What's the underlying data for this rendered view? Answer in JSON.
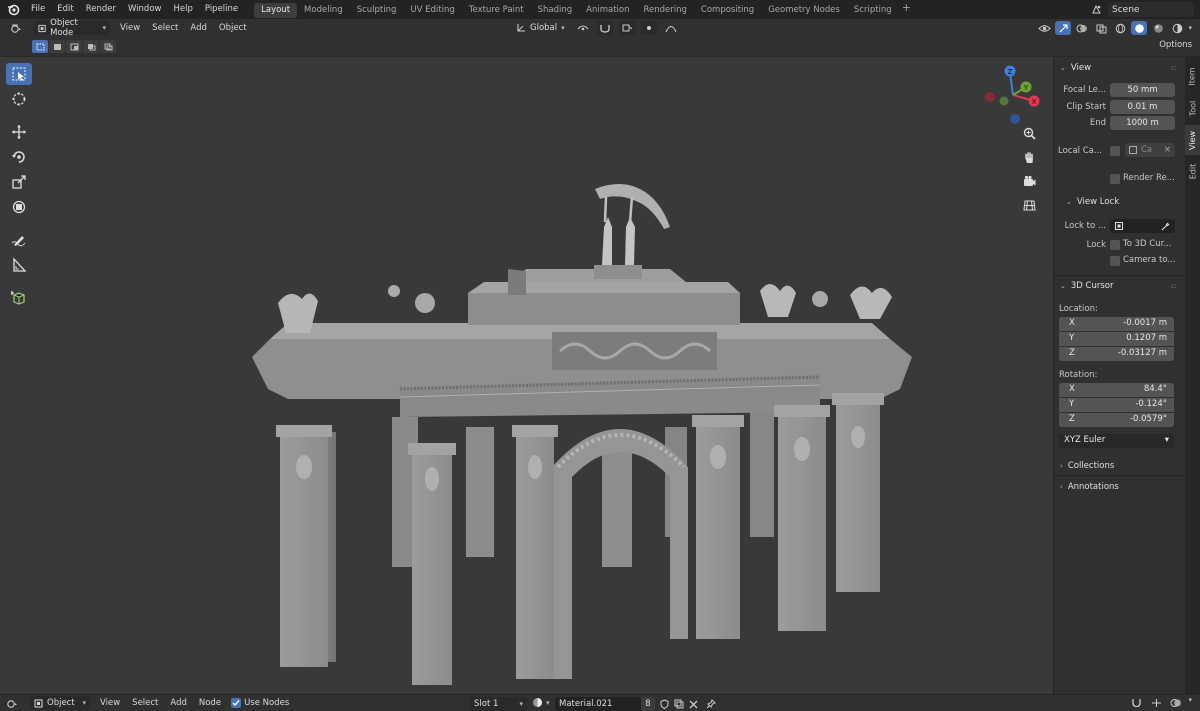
{
  "topbar": {
    "menus": [
      "File",
      "Edit",
      "Render",
      "Window",
      "Help",
      "Pipeline"
    ],
    "workspaces": [
      "Layout",
      "Modeling",
      "Sculpting",
      "UV Editing",
      "Texture Paint",
      "Shading",
      "Animation",
      "Rendering",
      "Compositing",
      "Geometry Nodes",
      "Scripting"
    ],
    "active_workspace": "Layout",
    "add_workspace": "+",
    "scene_name": "Scene"
  },
  "viewport_header": {
    "mode": "Object Mode",
    "menus": [
      "View",
      "Select",
      "Add",
      "Object"
    ],
    "orientation": "Global"
  },
  "tool_settings": {
    "options_label": "Options"
  },
  "sidebar": {
    "tabs": [
      "Item",
      "Tool",
      "View",
      "Edit"
    ],
    "active_tab": "View",
    "view_panel": {
      "title": "View",
      "focal_length_label": "Focal Le...",
      "focal_length_value": "50 mm",
      "clip_start_label": "Clip Start",
      "clip_start_value": "0.01 m",
      "clip_end_label": "End",
      "clip_end_value": "1000 m",
      "local_camera_label": "Local Ca...",
      "local_camera_value": "Ca",
      "render_region_label": "Render Re..."
    },
    "view_lock_panel": {
      "title": "View Lock",
      "lock_to_object_label": "Lock to ...",
      "lock_label": "Lock",
      "to_3d_cursor_label": "To 3D Cur...",
      "camera_to_view_label": "Camera to..."
    },
    "cursor_panel": {
      "title": "3D Cursor",
      "location_label": "Location:",
      "location": [
        {
          "axis": "X",
          "value": "-0.0017 m"
        },
        {
          "axis": "Y",
          "value": "0.1207 m"
        },
        {
          "axis": "Z",
          "value": "-0.03127 m"
        }
      ],
      "rotation_label": "Rotation:",
      "rotation": [
        {
          "axis": "X",
          "value": "84.4°"
        },
        {
          "axis": "Y",
          "value": "-0.124°"
        },
        {
          "axis": "Z",
          "value": "-0.0579°"
        }
      ],
      "rotation_mode": "XYZ Euler"
    },
    "collections_label": "Collections",
    "annotations_label": "Annotations"
  },
  "gizmo": {
    "x": "X",
    "y": "Y",
    "z": "Z"
  },
  "bottom_bar": {
    "object_label": "Object",
    "menus": [
      "View",
      "Select",
      "Add",
      "Node"
    ],
    "use_nodes_label": "Use Nodes",
    "slot_label": "Slot 1",
    "material_name": "Material.021",
    "user_count": "8"
  },
  "colors": {
    "accent": "#4772b3",
    "axis_x": "#e0394f",
    "axis_y": "#6ea236",
    "axis_z": "#3f7fe0",
    "viewport_bg": "#393939"
  }
}
